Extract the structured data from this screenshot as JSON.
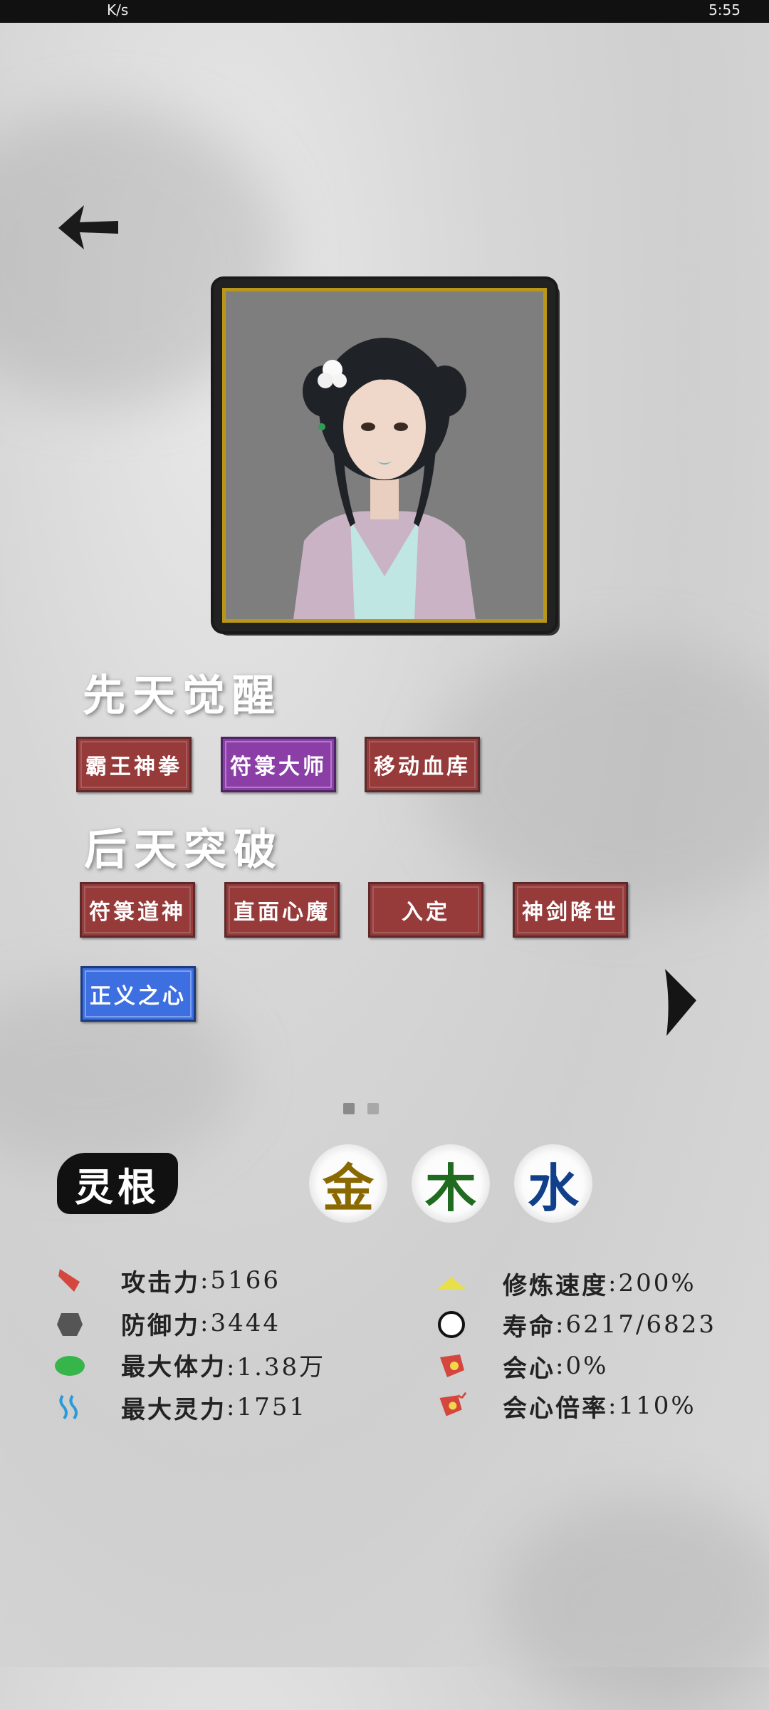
{
  "status_bar": {
    "left": "K/s",
    "right": "5:55"
  },
  "portrait": {
    "name": "character-portrait"
  },
  "sections": {
    "innate_title": "先天觉醒",
    "acquired_title": "后天突破"
  },
  "innate_skills": [
    "霸王神拳",
    "符箓大师",
    "移动血库"
  ],
  "acquired_skills": [
    "符箓道神",
    "直面心魔",
    "入定",
    "神剑降世",
    "正义之心"
  ],
  "spirit_root": {
    "label": "灵根",
    "elements": [
      {
        "char": "金",
        "color": "#8a6a00"
      },
      {
        "char": "木",
        "color": "#1f6b1f"
      },
      {
        "char": "水",
        "color": "#123f8a"
      }
    ]
  },
  "stats_left": [
    {
      "label": "攻击力",
      "value": ":5166",
      "icon": "attack-icon"
    },
    {
      "label": "防御力",
      "value": ":3444",
      "icon": "defense-icon"
    },
    {
      "label": "最大体力",
      "value": ":1.38万",
      "icon": "stamina-icon"
    },
    {
      "label": "最大灵力",
      "value": ":1751",
      "icon": "spirit-icon"
    }
  ],
  "stats_right": [
    {
      "label": "修炼速度",
      "value": ":200%",
      "icon": "cultivation-icon"
    },
    {
      "label": "寿命",
      "value": ":6217/6823",
      "icon": "lifespan-icon"
    },
    {
      "label": "会心",
      "value": ":0%",
      "icon": "critical-icon"
    },
    {
      "label": "会心倍率",
      "value": ":110%",
      "icon": "critical-rate-icon"
    }
  ],
  "colors": {
    "skill_red": "#963a3a",
    "skill_purple": "#8a3ea6",
    "skill_blue": "#3d6fe0",
    "frame_gold": "#b9971a"
  }
}
